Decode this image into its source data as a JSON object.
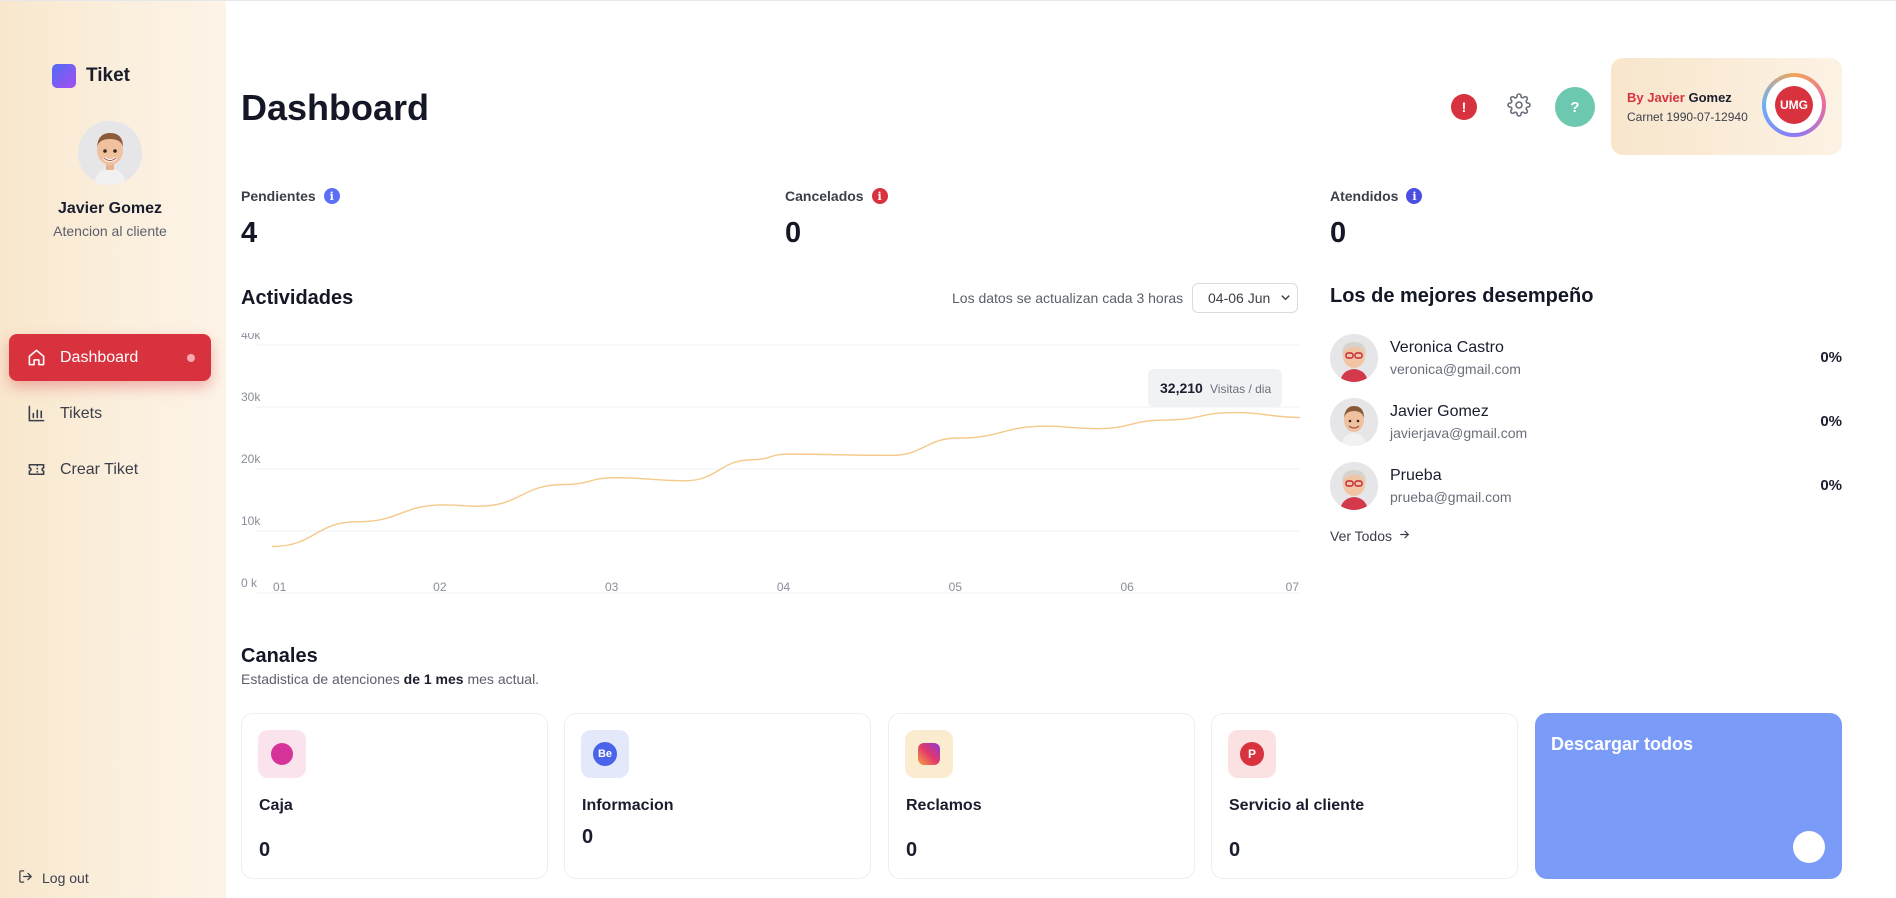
{
  "brand": {
    "name": "Tiket"
  },
  "profile": {
    "name": "Javier Gomez",
    "role": "Atencion al cliente"
  },
  "nav": [
    {
      "label": "Dashboard",
      "icon": "home-icon",
      "active": true
    },
    {
      "label": "Tikets",
      "icon": "bar-chart-icon",
      "active": false
    },
    {
      "label": "Crear Tiket",
      "icon": "ticket-icon",
      "active": false
    }
  ],
  "logout": {
    "label": "Log out"
  },
  "header": {
    "title": "Dashboard",
    "alert_icon_text": "!",
    "help_icon_text": "?"
  },
  "user_card": {
    "by_prefix": "By Javier",
    "by_suffix": "Gomez",
    "carnet": "Carnet 1990-07-12940",
    "logo_text": "UMG"
  },
  "stats": [
    {
      "label": "Pendientes",
      "value": "4",
      "info_color": "#5b6ef5"
    },
    {
      "label": "Cancelados",
      "value": "0",
      "info_color": "#d9323f"
    },
    {
      "label": "Atendidos",
      "value": "0",
      "info_color": "#4b4fe0"
    }
  ],
  "activities": {
    "title": "Actividades",
    "note": "Los datos se actualizan cada 3 horas",
    "date_range": "04-06 Jun"
  },
  "chart_data": {
    "type": "line",
    "x": [
      "01",
      "02",
      "03",
      "04",
      "05",
      "06",
      "07"
    ],
    "y_ticks": [
      "0 k",
      "10k",
      "20k",
      "30k",
      "40k"
    ],
    "ylim": [
      0,
      40000
    ],
    "series": [
      {
        "values": [
          [
            1.0,
            7500
          ],
          [
            1.5,
            11500
          ],
          [
            2.0,
            14200
          ],
          [
            2.2,
            14000
          ],
          [
            2.7,
            17500
          ],
          [
            3.0,
            18600
          ],
          [
            3.4,
            18100
          ],
          [
            3.8,
            21500
          ],
          [
            4.0,
            22400
          ],
          [
            4.6,
            22200
          ],
          [
            5.0,
            25000
          ],
          [
            5.5,
            26900
          ],
          [
            5.8,
            26500
          ],
          [
            6.2,
            27900
          ],
          [
            6.6,
            29100
          ],
          [
            7.0,
            28300
          ]
        ],
        "color": "#f5c98a"
      }
    ],
    "tooltip": {
      "value": "32,210",
      "unit": "Visitas / dia"
    },
    "grid": true
  },
  "performers": {
    "title": "Los de mejores desempeño",
    "items": [
      {
        "name": "Veronica Castro",
        "email": "veronica@gmail.com",
        "percent": "0%",
        "avatar": "female-avatar"
      },
      {
        "name": "Javier Gomez",
        "email": "javierjava@gmail.com",
        "percent": "0%",
        "avatar": "male-avatar"
      },
      {
        "name": "Prueba",
        "email": "prueba@gmail.com",
        "percent": "0%",
        "avatar": "female-avatar"
      }
    ],
    "see_all": "Ver Todos"
  },
  "channels": {
    "title": "Canales",
    "subtitle_pre": "Estadistica de atenciones",
    "subtitle_bold": "de 1 mes",
    "subtitle_post": "mes actual.",
    "items": [
      {
        "label": "Caja",
        "value": "0",
        "icon": "dribbble-icon",
        "icon_bg": "#fbe3ee"
      },
      {
        "label": "Informacion",
        "value": "0",
        "icon": "behance-icon",
        "icon_bg": "#e3e8fb",
        "icon_text": "Be"
      },
      {
        "label": "Reclamos",
        "value": "0",
        "icon": "instagram-icon",
        "icon_bg": "#fbeccf"
      },
      {
        "label": "Servicio al cliente",
        "value": "0",
        "icon": "pinterest-icon",
        "icon_bg": "#fbe1e1",
        "icon_text": "P"
      }
    ],
    "download": {
      "label": "Descargar todos",
      "color": "#7b9bf8"
    }
  }
}
